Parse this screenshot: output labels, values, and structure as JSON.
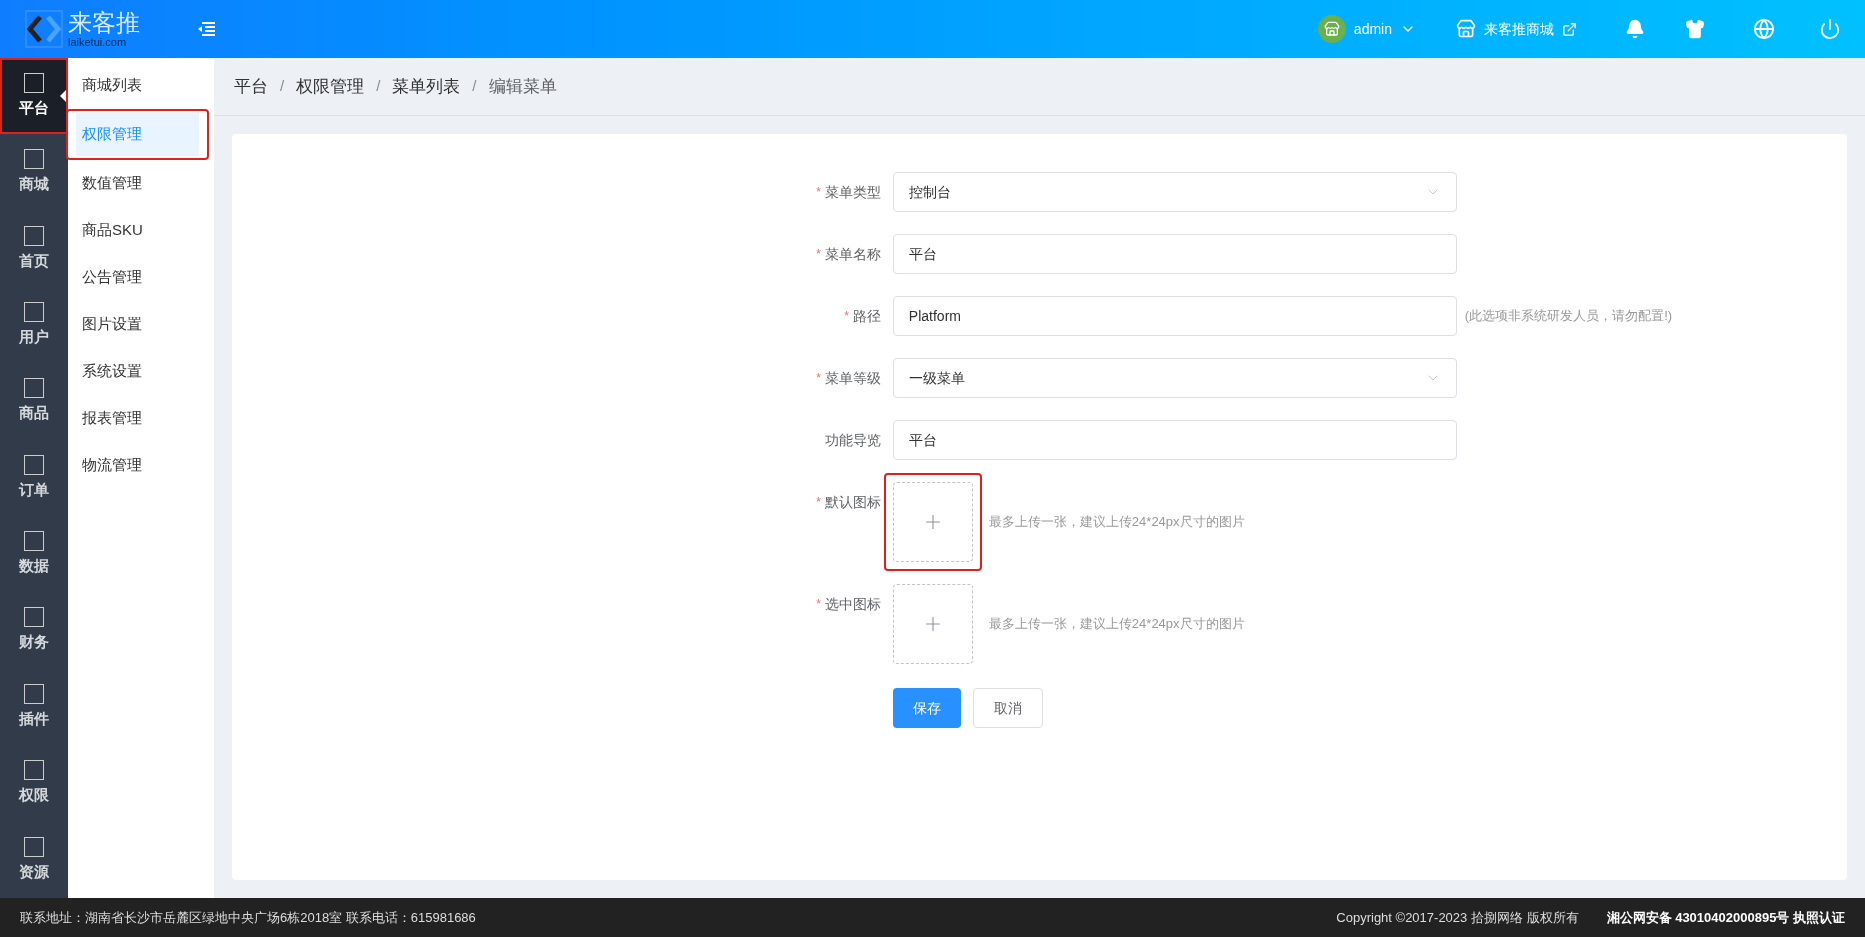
{
  "header": {
    "logo_text": "来客推",
    "logo_sub": "laiketui.com",
    "user": "admin",
    "store": "来客推商城"
  },
  "rail": [
    {
      "label": "平台",
      "selected": true,
      "highlighted": true
    },
    {
      "label": "商城",
      "selected": false,
      "highlighted": false
    },
    {
      "label": "首页",
      "selected": false,
      "highlighted": false
    },
    {
      "label": "用户",
      "selected": false,
      "highlighted": false
    },
    {
      "label": "商品",
      "selected": false,
      "highlighted": false
    },
    {
      "label": "订单",
      "selected": false,
      "highlighted": false
    },
    {
      "label": "数据",
      "selected": false,
      "highlighted": false
    },
    {
      "label": "财务",
      "selected": false,
      "highlighted": false
    },
    {
      "label": "插件",
      "selected": false,
      "highlighted": false
    },
    {
      "label": "权限",
      "selected": false,
      "highlighted": false
    },
    {
      "label": "资源",
      "selected": false,
      "highlighted": false
    }
  ],
  "submenu": [
    {
      "label": "商城列表",
      "selected": false,
      "highlighted": false
    },
    {
      "label": "权限管理",
      "selected": true,
      "highlighted": true
    },
    {
      "label": "数值管理",
      "selected": false,
      "highlighted": false
    },
    {
      "label": "商品SKU",
      "selected": false,
      "highlighted": false
    },
    {
      "label": "公告管理",
      "selected": false,
      "highlighted": false
    },
    {
      "label": "图片设置",
      "selected": false,
      "highlighted": false
    },
    {
      "label": "系统设置",
      "selected": false,
      "highlighted": false
    },
    {
      "label": "报表管理",
      "selected": false,
      "highlighted": false
    },
    {
      "label": "物流管理",
      "selected": false,
      "highlighted": false
    }
  ],
  "breadcrumb": {
    "separator": "/",
    "items": [
      "平台",
      "权限管理",
      "菜单列表",
      "编辑菜单"
    ]
  },
  "form": {
    "fields": [
      {
        "kind": "select",
        "label": "菜单类型",
        "required": true,
        "value": "控制台"
      },
      {
        "kind": "input",
        "label": "菜单名称",
        "required": true,
        "value": "平台"
      },
      {
        "kind": "input",
        "label": "路径",
        "required": true,
        "value": "Platform",
        "hint": "(此选项非系统研发人员，请勿配置!)"
      },
      {
        "kind": "select",
        "label": "菜单等级",
        "required": true,
        "value": "一级菜单"
      },
      {
        "kind": "input",
        "label": "功能导览",
        "required": false,
        "value": "平台"
      },
      {
        "kind": "upload",
        "label": "默认图标",
        "required": true,
        "highlighted": true,
        "hint": "最多上传一张，建议上传24*24px尺寸的图片"
      },
      {
        "kind": "upload",
        "label": "选中图标",
        "required": true,
        "highlighted": false,
        "hint": "最多上传一张，建议上传24*24px尺寸的图片"
      }
    ],
    "required_mark": "*",
    "buttons": [
      "保存",
      "取消"
    ]
  },
  "footer": {
    "address": "联系地址：湖南省长沙市岳麓区绿地中央广场6栋2018室 联系电话：615981686",
    "copyright": "Copyright ©2017-2023 拾捌网络 版权所有",
    "record": "湘公网安备 43010402000895号 执照认证"
  }
}
